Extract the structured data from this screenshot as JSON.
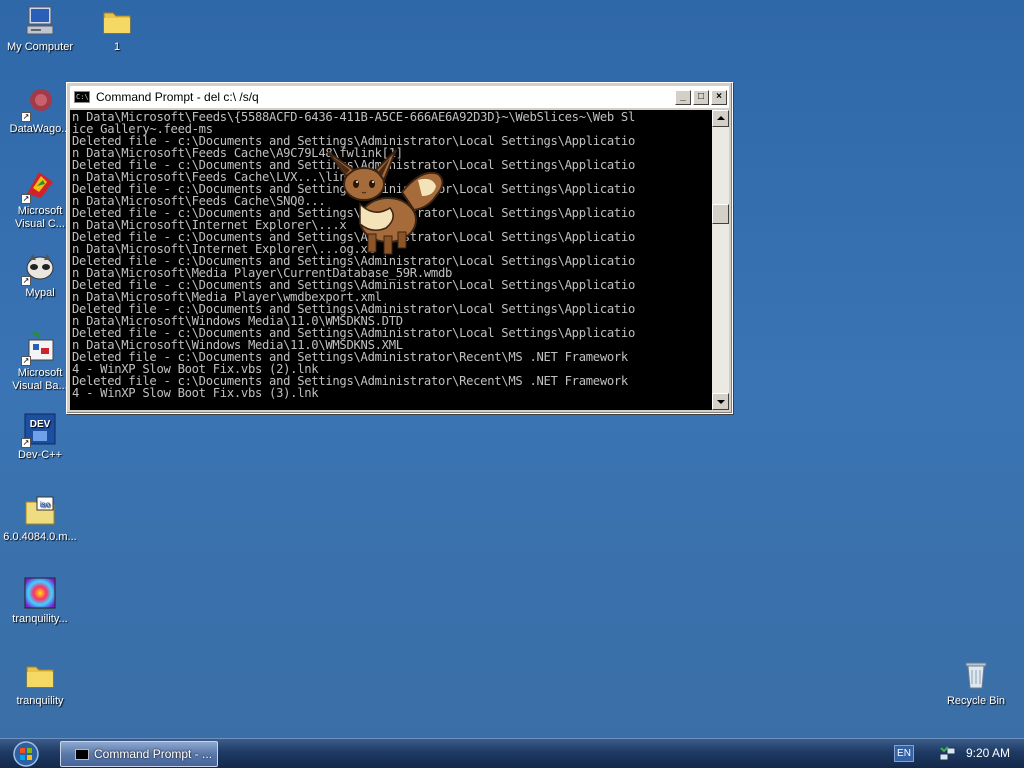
{
  "desktop": {
    "icons": [
      {
        "label": "My Computer"
      },
      {
        "label": "1"
      },
      {
        "label": "DataWago..."
      },
      {
        "label": "Microsoft Visual C..."
      },
      {
        "label": "Mypal"
      },
      {
        "label": "Microsoft Visual Ba..."
      },
      {
        "label": "Dev-C++"
      },
      {
        "label": "6.0.4084.0.m..."
      },
      {
        "label": "tranquility..."
      },
      {
        "label": "tranquility"
      },
      {
        "label": "Recycle Bin"
      }
    ],
    "icon_names": [
      "my-computer-icon",
      "folder-icon",
      "datawago-icon",
      "visual-c-icon",
      "mypal-icon",
      "visual-basic-icon",
      "devcpp-icon",
      "iso-file-icon",
      "tranquility-image-icon",
      "folder-icon",
      "recycle-bin-icon"
    ]
  },
  "window": {
    "title": "Command Prompt - del c:\\ /s/q",
    "icon_text": "C:\\",
    "min_label": "_",
    "max_label": "□",
    "close_label": "×",
    "console_lines": [
      "n Data\\Microsoft\\Feeds\\{5588ACFD-6436-411B-A5CE-666AE6A92D3D}~\\WebSlices~\\Web Sl",
      "ice Gallery~.feed-ms",
      "Deleted file - c:\\Documents and Settings\\Administrator\\Local Settings\\Applicatio",
      "n Data\\Microsoft\\Feeds Cache\\A9C79L48\\fwlink[1]",
      "Deleted file - c:\\Documents and Settings\\Administrator\\Local Settings\\Applicatio",
      "n Data\\Microsoft\\Feeds Cache\\LVX...\\link",
      "Deleted file - c:\\Documents and Settings\\Administrator\\Local Settings\\Applicatio",
      "n Data\\Microsoft\\Feeds Cache\\SNQ0...",
      "Deleted file - c:\\Documents and Settings\\Administrator\\Local Settings\\Applicatio",
      "n Data\\Microsoft\\Internet Explorer\\...x",
      "Deleted file - c:\\Documents and Settings\\Administrator\\Local Settings\\Applicatio",
      "n Data\\Microsoft\\Internet Explorer\\...og.xt",
      "Deleted file - c:\\Documents and Settings\\Administrator\\Local Settings\\Applicatio",
      "n Data\\Microsoft\\Media Player\\CurrentDatabase_59R.wmdb",
      "Deleted file - c:\\Documents and Settings\\Administrator\\Local Settings\\Applicatio",
      "n Data\\Microsoft\\Media Player\\wmdbexport.xml",
      "Deleted file - c:\\Documents and Settings\\Administrator\\Local Settings\\Applicatio",
      "n Data\\Microsoft\\Windows Media\\11.0\\WMSDKNS.DTD",
      "Deleted file - c:\\Documents and Settings\\Administrator\\Local Settings\\Applicatio",
      "n Data\\Microsoft\\Windows Media\\11.0\\WMSDKNS.XML",
      "Deleted file - c:\\Documents and Settings\\Administrator\\Recent\\MS .NET Framework",
      "4 - WinXP Slow Boot Fix.vbs (2).lnk",
      "Deleted file - c:\\Documents and Settings\\Administrator\\Recent\\MS .NET Framework",
      "4 - WinXP Slow Boot Fix.vbs (3).lnk"
    ]
  },
  "taskbar": {
    "task_label": "Command Prompt - ...",
    "language": "EN",
    "clock": "9:20 AM"
  },
  "colors": {
    "desktop": "#3a6ea5",
    "console_bg": "#000000",
    "console_text": "#c0c0c0"
  }
}
